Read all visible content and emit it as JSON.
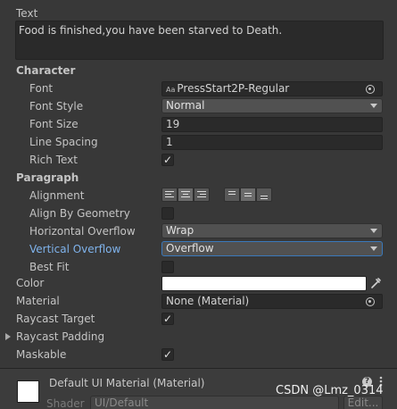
{
  "text_component": {
    "label": "Text",
    "value": "Food is finished,you have been starved to Death."
  },
  "character": {
    "heading": "Character",
    "font_label": "Font",
    "font_icon": "Aa",
    "font_value": "PressStart2P-Regular",
    "font_style_label": "Font Style",
    "font_style_value": "Normal",
    "font_size_label": "Font Size",
    "font_size_value": "19",
    "line_spacing_label": "Line Spacing",
    "line_spacing_value": "1",
    "rich_text_label": "Rich Text",
    "rich_text_checked": true
  },
  "paragraph": {
    "heading": "Paragraph",
    "alignment_label": "Alignment",
    "alignment_horizontal_selected": "center",
    "alignment_vertical_selected": "middle",
    "align_by_geometry_label": "Align By Geometry",
    "align_by_geometry_checked": false,
    "horizontal_overflow_label": "Horizontal Overflow",
    "horizontal_overflow_value": "Wrap",
    "vertical_overflow_label": "Vertical Overflow",
    "vertical_overflow_value": "Overflow",
    "best_fit_label": "Best Fit",
    "best_fit_checked": false
  },
  "color": {
    "label": "Color",
    "value_hex": "#ffffff"
  },
  "material": {
    "label": "Material",
    "value": "None (Material)"
  },
  "raycast_target": {
    "label": "Raycast Target",
    "checked": true
  },
  "raycast_padding": {
    "label": "Raycast Padding"
  },
  "maskable": {
    "label": "Maskable",
    "checked": true
  },
  "material_preview": {
    "title": "Default UI Material (Material)",
    "shader_label": "Shader",
    "shader_value": "UI/Default",
    "edit_label": "Edit..."
  },
  "watermark": "CSDN @Lmz_0314",
  "colors": {
    "background": "#383838",
    "field_bg": "#2a2a2a",
    "highlight_label": "#7fb3ec",
    "focus_border": "#3a79bb"
  }
}
